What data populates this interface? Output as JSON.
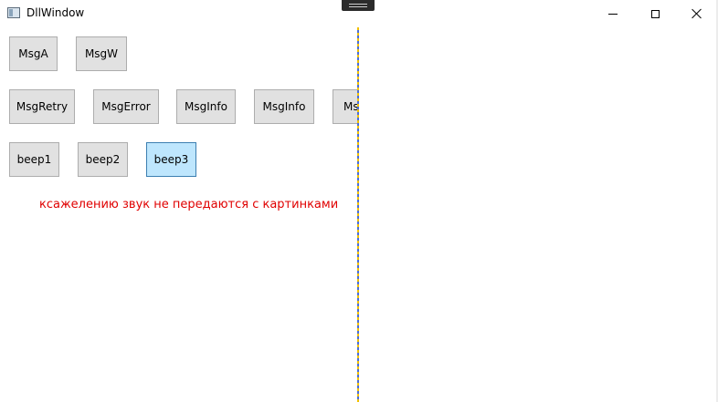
{
  "window": {
    "title": "DllWindow",
    "icon": "app-window-icon",
    "controls": [
      "minimize-icon",
      "maximize-icon",
      "close-icon"
    ]
  },
  "rows": {
    "row1": [
      "MsgA",
      "MsgW"
    ],
    "row2": [
      "MsgRetry",
      "MsgError",
      "MsgInfo",
      "MsgInfo",
      "Ms"
    ],
    "row3": [
      "beep1",
      "beep2",
      "beep3"
    ]
  },
  "message": "ксажелению звук не передаются с картинками",
  "colors": {
    "message": "#e00000",
    "button_bg": "#e1e1e1",
    "button_active_bg": "#bee6fd",
    "divider_dash_a": "#f0c000",
    "divider_dash_b": "#4b6ed9"
  }
}
